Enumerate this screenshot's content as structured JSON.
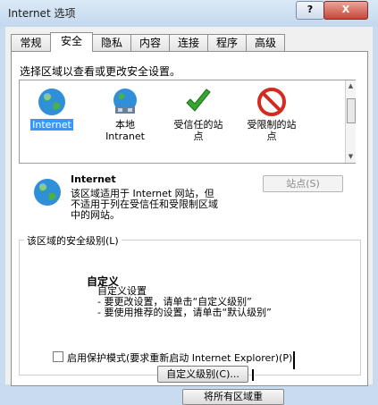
{
  "window": {
    "title": "Internet 选项",
    "help": "?",
    "close": "X"
  },
  "tabs": [
    "常规",
    "安全",
    "隐私",
    "内容",
    "连接",
    "程序",
    "高级"
  ],
  "security": {
    "instruction": "选择区域以查看或更改安全设置。",
    "zones": [
      {
        "label1": "Internet",
        "label2": "",
        "icon": "globe-icon",
        "selected": true
      },
      {
        "label1": "本地",
        "label2": "Intranet",
        "icon": "intranet-globe-icon",
        "selected": false
      },
      {
        "label1": "受信任的站",
        "label2": "点",
        "icon": "checkmark-icon",
        "selected": false
      },
      {
        "label1": "受限制的站",
        "label2": "点",
        "icon": "restricted-icon",
        "selected": false
      }
    ],
    "zone_detail": {
      "name": "Internet",
      "desc1": "该区域适用于 Internet 网站，但",
      "desc2": "不适用于列在受信任和受限制区域",
      "desc3": "中的网站。",
      "sites_button": "站点(S)"
    },
    "level": {
      "legend": "该区域的安全级别(L)",
      "title": "自定义",
      "line1": "自定义设置",
      "line2": "- 要更改设置，请单击“自定义级别”",
      "line3": "- 要使用推荐的设置，请单击“默认级别”"
    },
    "protected_mode": {
      "label": "启用保护模式(要求重新启动 Internet Explorer)(P)",
      "checked": false
    },
    "custom_level_button": "自定义级别(C)...",
    "reset_all_button": "将所有区域重"
  }
}
